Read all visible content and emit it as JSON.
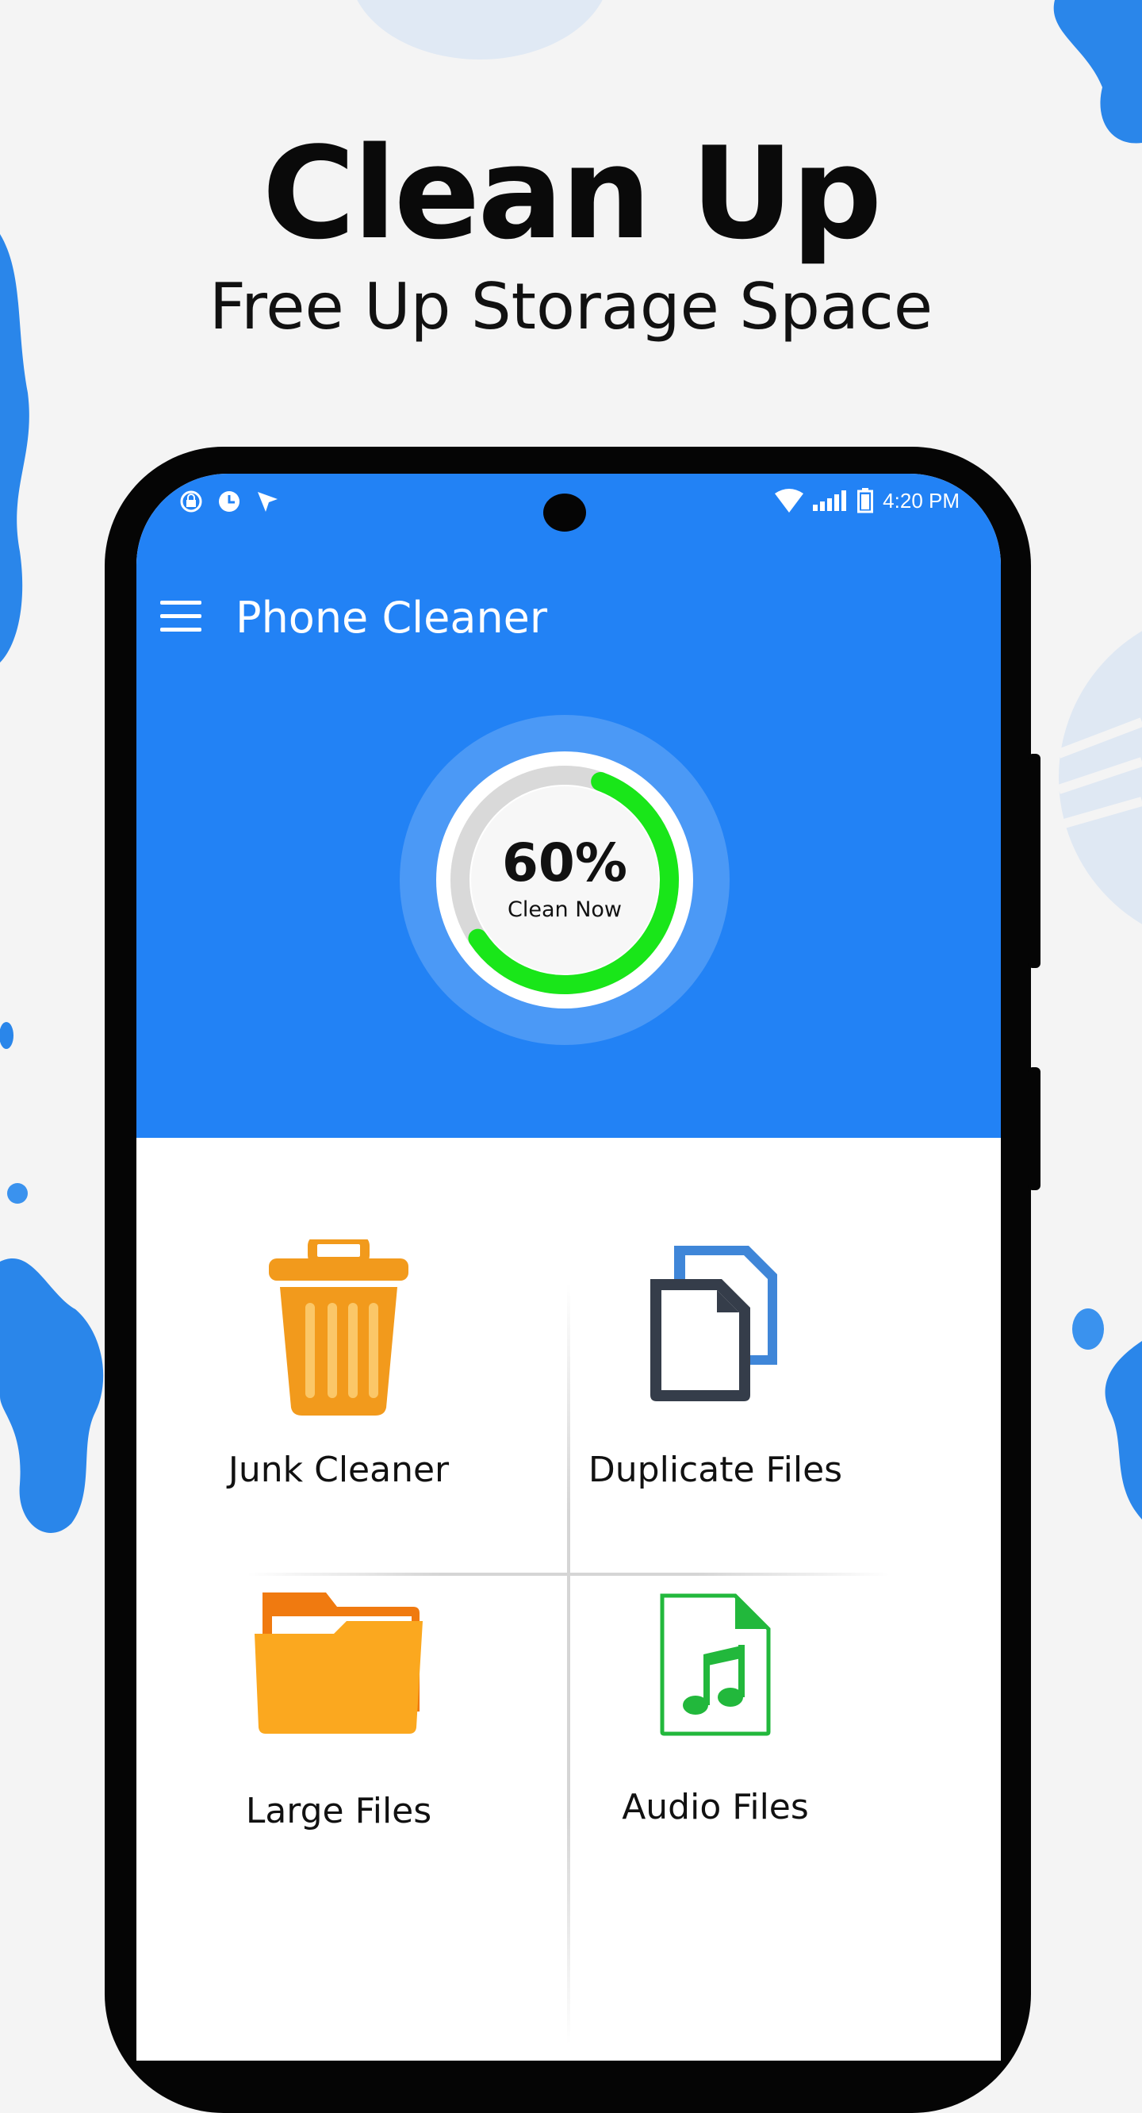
{
  "headline": "Clean Up",
  "subheadline": "Free Up Storage Space",
  "status_bar": {
    "time": "4:20 PM",
    "left_icons": [
      "vpn-lock-icon",
      "clock-icon",
      "location-arrow-icon"
    ],
    "right_icons": [
      "wifi-icon",
      "signal-icon",
      "battery-icon"
    ]
  },
  "app_bar": {
    "title": "Phone Cleaner",
    "menu_icon": "hamburger-menu-icon"
  },
  "gauge": {
    "value": "60%",
    "caption": "Clean Now",
    "progress_fraction": 0.6,
    "progress_color": "#19e619"
  },
  "tiles": [
    {
      "label": "Junk Cleaner",
      "icon": "trash-bin-icon"
    },
    {
      "label": "Duplicate Files",
      "icon": "duplicate-documents-icon"
    },
    {
      "label": "Large Files",
      "icon": "folder-icon"
    },
    {
      "label": "Audio Files",
      "icon": "music-file-icon"
    }
  ],
  "colors": {
    "primary": "#2282f5",
    "background": "#f4f4f4",
    "junk": "#f29a1c",
    "folder": "#fba81f",
    "audio": "#22b83c"
  }
}
